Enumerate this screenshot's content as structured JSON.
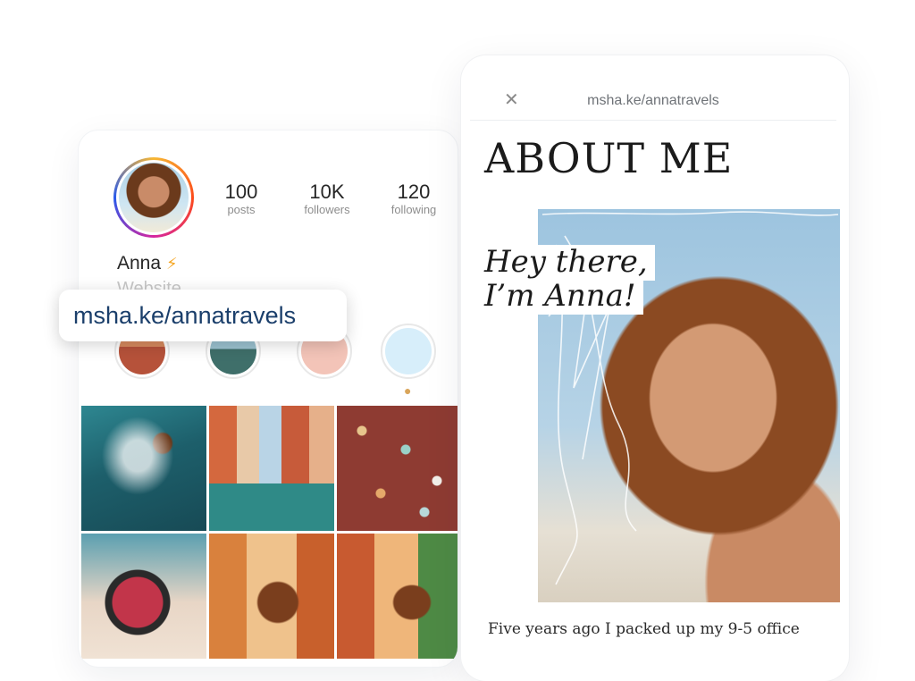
{
  "profile": {
    "stats": [
      {
        "value": "100",
        "label": "posts"
      },
      {
        "value": "10K",
        "label": "followers"
      },
      {
        "value": "120",
        "label": "following"
      }
    ],
    "name": "Anna",
    "name_icon": "lightning-bolt-icon",
    "website_label": "Website",
    "bio_link": "msha.ke/annatravels",
    "highlight_icon": "palette-icon"
  },
  "about_page": {
    "browser_url": "msha.ke/annatravels",
    "title": "ABOUT ME",
    "greeting_line1": "Hey there,",
    "greeting_line2": "I’m Anna!",
    "body_start": "Five years ago I packed up my 9-5 office"
  }
}
